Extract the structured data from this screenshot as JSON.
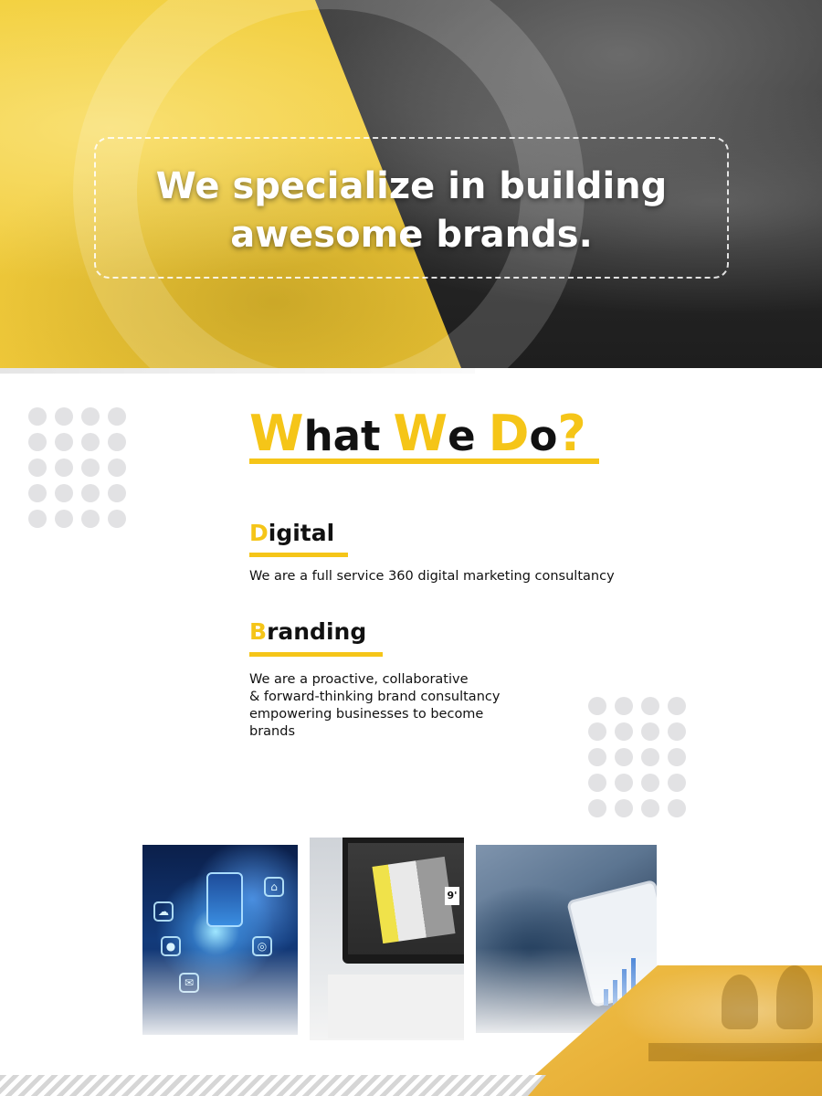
{
  "hero": {
    "headline_line1": "We specialize in building",
    "headline_line2": "awesome brands."
  },
  "section": {
    "title_parts": [
      "W",
      "hat",
      "W",
      "e",
      "D",
      "o",
      "?"
    ],
    "title_text": "What We Do?"
  },
  "services": [
    {
      "title_initial": "D",
      "title_rest": "igital",
      "description": "We are a full service 360 digital marketing consultancy"
    },
    {
      "title_initial": "B",
      "title_rest": "randing",
      "description_lines": [
        "We are a proactive, collaborative",
        "& forward-thinking brand consultancy",
        "empowering businesses to become",
        "brands"
      ]
    }
  ],
  "images": [
    {
      "icon": "digital-network-image"
    },
    {
      "icon": "design-monitor-image",
      "label": "9'"
    },
    {
      "icon": "tablet-analytics-image"
    }
  ],
  "colors": {
    "accent_yellow": "#f5c518",
    "text": "#111111",
    "dot_gray": "#e2e2e4"
  }
}
